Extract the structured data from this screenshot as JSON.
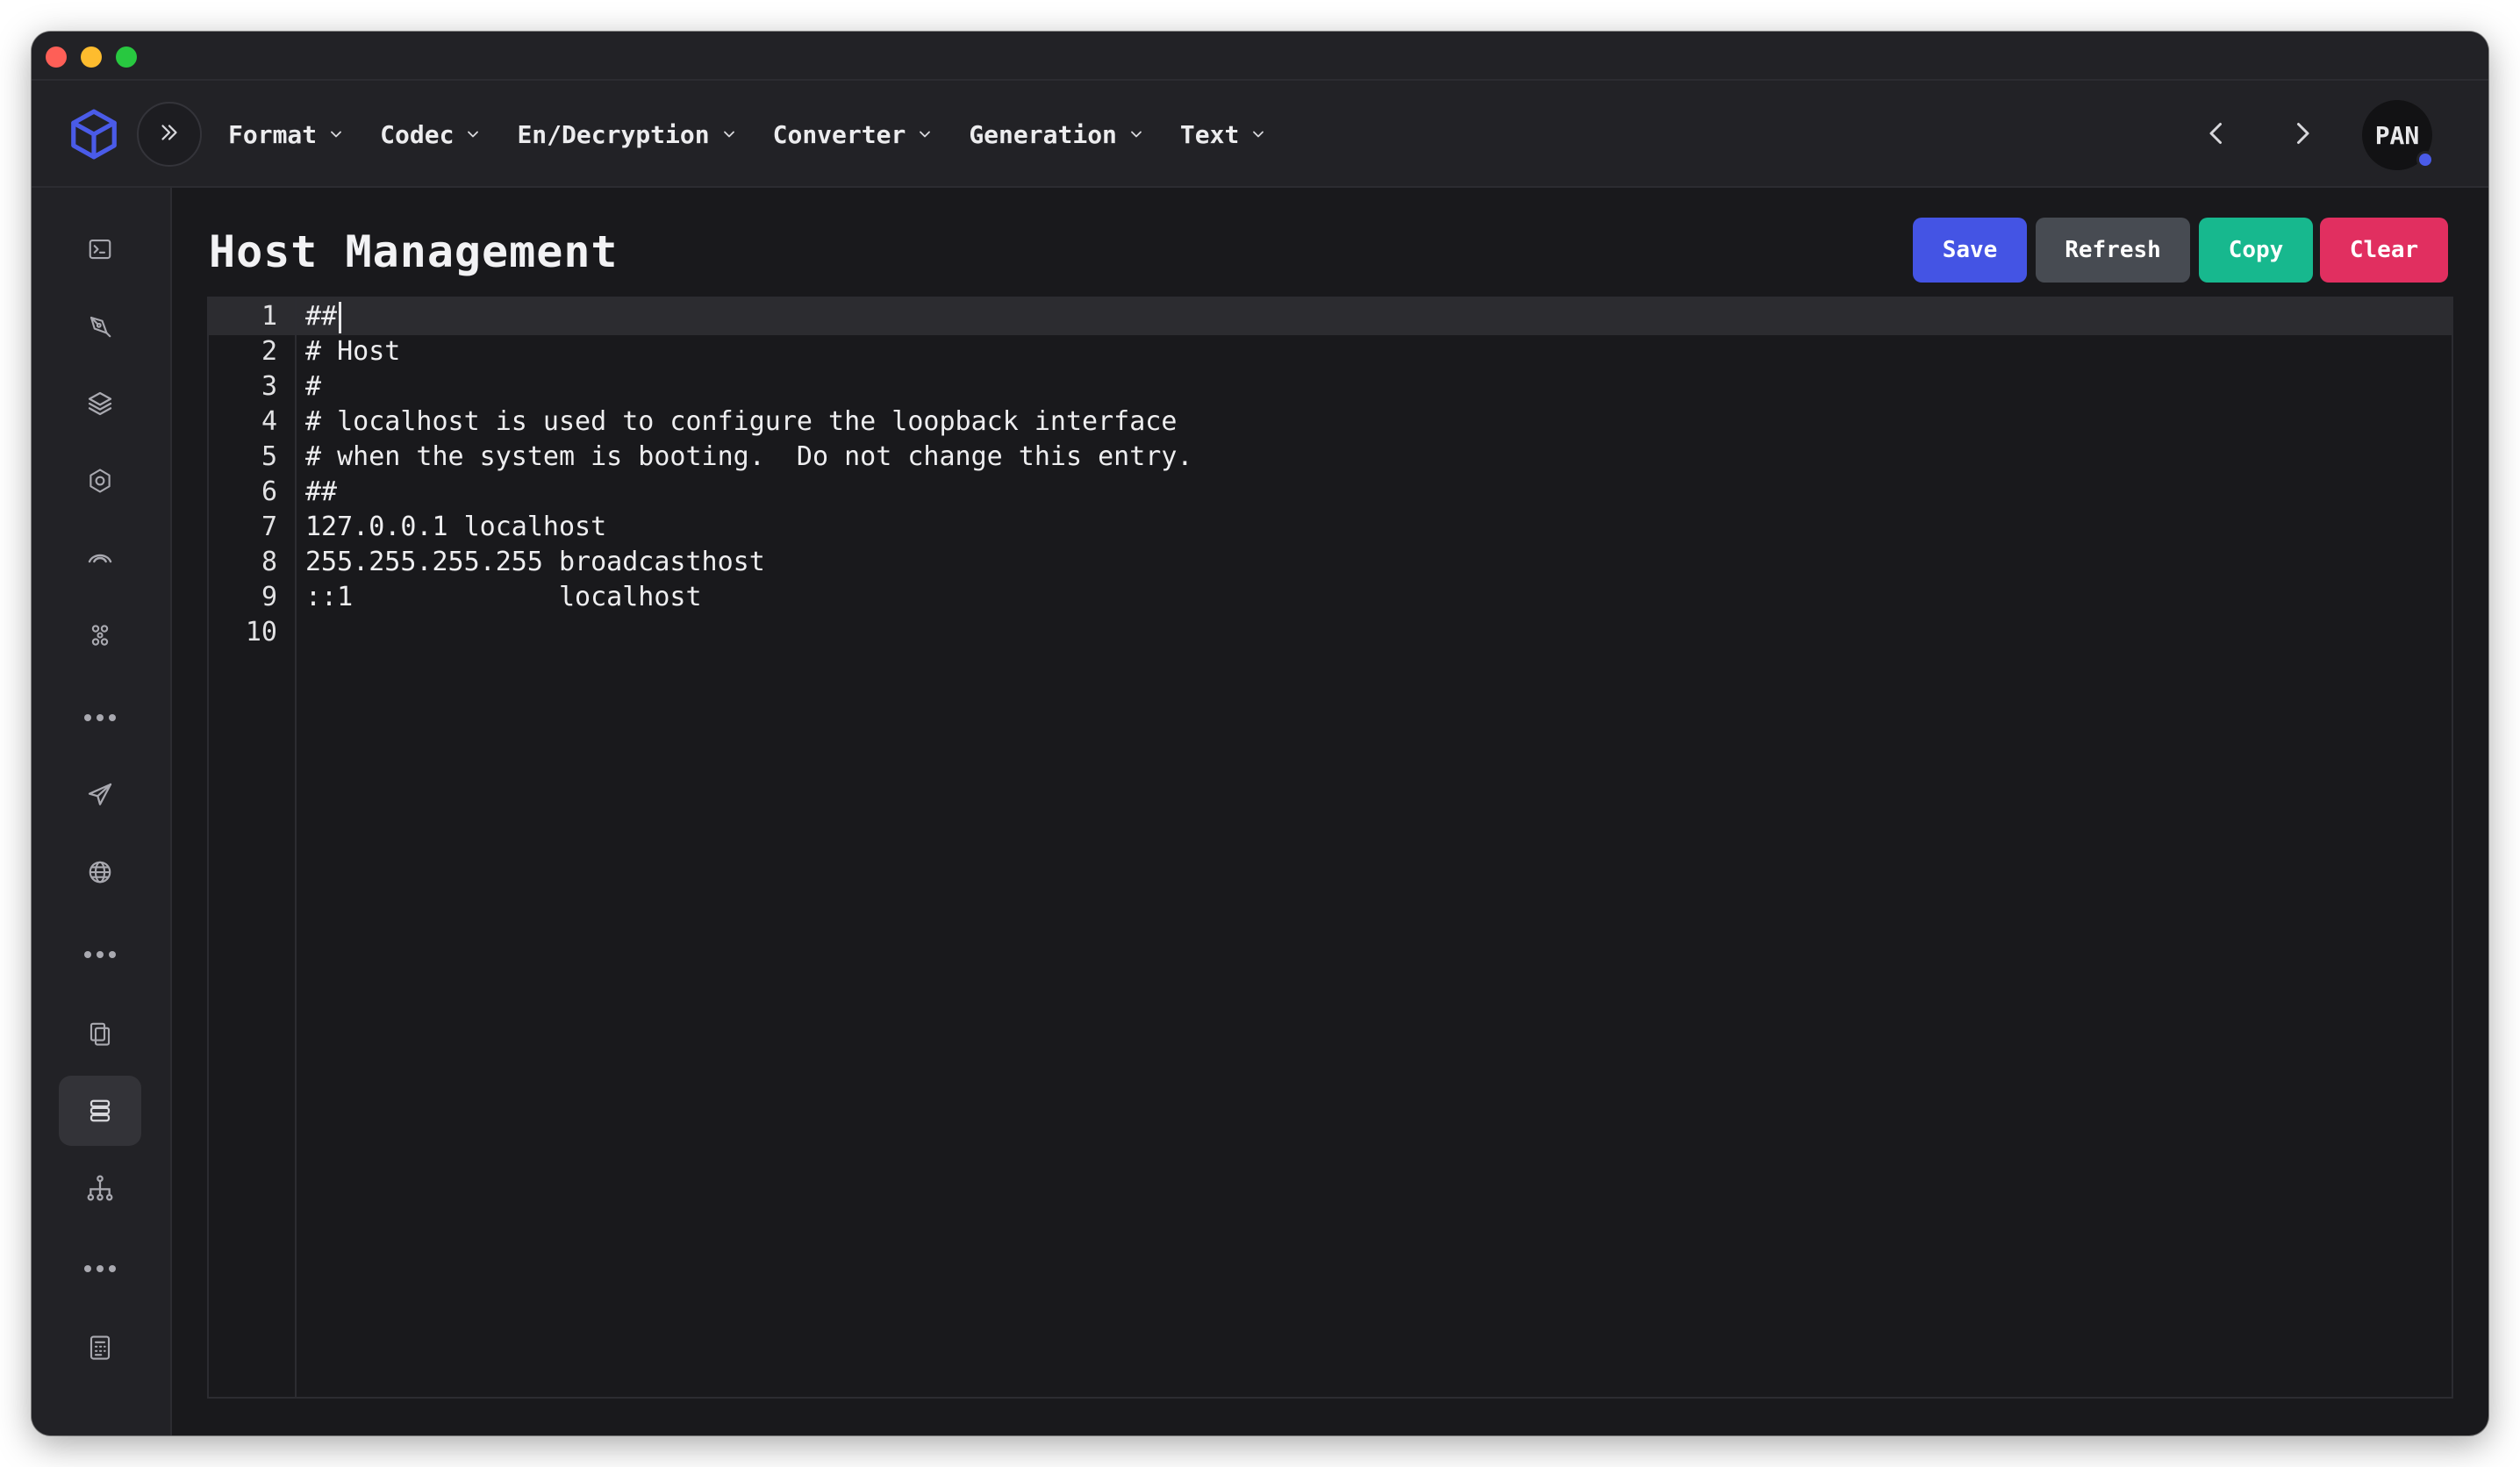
{
  "window": {
    "controls": [
      "close",
      "minimize",
      "maximize"
    ]
  },
  "nav": {
    "logo_icon": "cube-icon",
    "expand_icon": "double-chevron-right-icon",
    "menu": [
      {
        "label": "Format"
      },
      {
        "label": "Codec"
      },
      {
        "label": "En/Decryption"
      },
      {
        "label": "Converter"
      },
      {
        "label": "Generation"
      },
      {
        "label": "Text"
      }
    ],
    "back_icon": "chevron-left-icon",
    "forward_icon": "chevron-right-icon",
    "avatar": "PAN",
    "accent_color": "#4a5be8"
  },
  "sidebar": {
    "items": [
      {
        "icon": "terminal-icon"
      },
      {
        "icon": "pen-tool-icon"
      },
      {
        "icon": "layers-icon"
      },
      {
        "icon": "settings-gear-icon"
      },
      {
        "icon": "rainbow-icon"
      },
      {
        "icon": "command-icon"
      },
      {
        "icon": "more-dots-icon"
      },
      {
        "icon": "send-icon"
      },
      {
        "icon": "globe-icon"
      },
      {
        "icon": "more-dots-icon"
      },
      {
        "icon": "copy-files-icon"
      },
      {
        "icon": "database-list-icon",
        "active": true
      },
      {
        "icon": "sitemap-icon"
      },
      {
        "icon": "more-dots-icon"
      },
      {
        "icon": "calculator-icon"
      }
    ]
  },
  "page": {
    "title": "Host Management",
    "buttons": {
      "save": "Save",
      "refresh": "Refresh",
      "copy": "Copy",
      "clear": "Clear"
    },
    "button_colors": {
      "save": "#4454e4",
      "refresh": "#474b52",
      "copy": "#17b88e",
      "clear": "#e12f60"
    }
  },
  "editor": {
    "active_line": 1,
    "lines": [
      {
        "n": "1",
        "text": "##"
      },
      {
        "n": "2",
        "text": "# Host"
      },
      {
        "n": "3",
        "text": "#"
      },
      {
        "n": "4",
        "text": "# localhost is used to configure the loopback interface"
      },
      {
        "n": "5",
        "text": "# when the system is booting.  Do not change this entry."
      },
      {
        "n": "6",
        "text": "##"
      },
      {
        "n": "7",
        "text": "127.0.0.1 localhost"
      },
      {
        "n": "8",
        "text": "255.255.255.255 broadcasthost"
      },
      {
        "n": "9",
        "text": "::1             localhost"
      },
      {
        "n": "10",
        "text": ""
      }
    ]
  }
}
